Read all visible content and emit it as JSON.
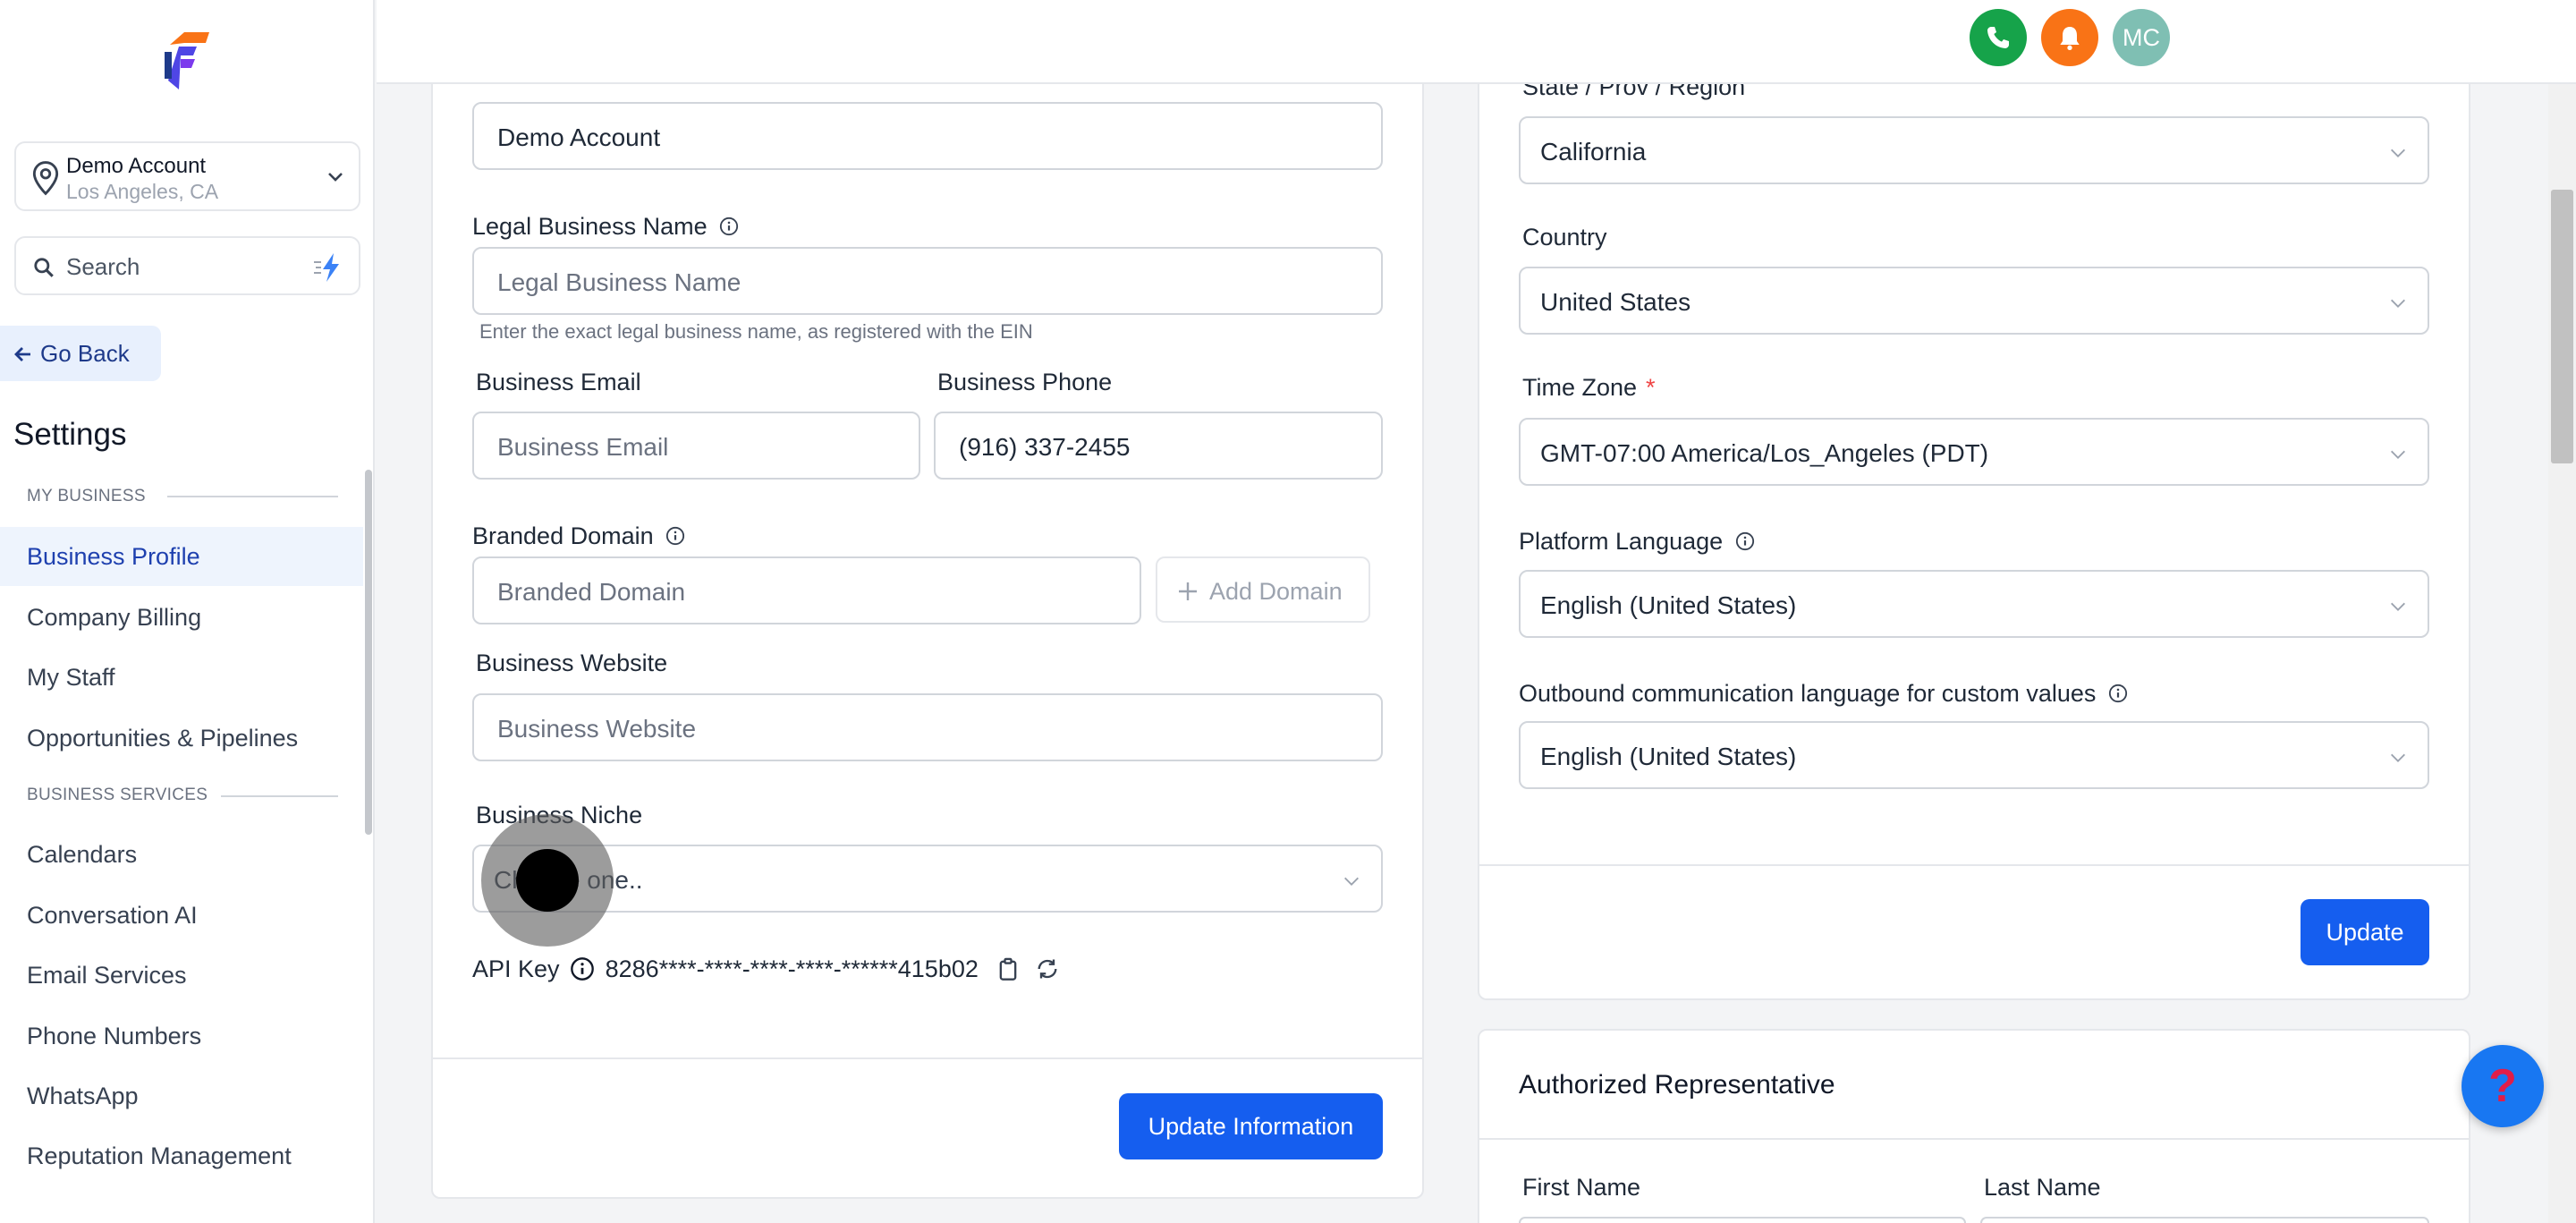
{
  "sidebar": {
    "account": {
      "name": "Demo Account",
      "location": "Los Angeles, CA"
    },
    "search": {
      "label": "Search"
    },
    "go_back": "Go Back",
    "title": "Settings",
    "sections": [
      {
        "heading": "MY BUSINESS",
        "items": [
          "Business Profile",
          "Company Billing",
          "My Staff",
          "Opportunities & Pipelines"
        ]
      },
      {
        "heading": "BUSINESS SERVICES",
        "items": [
          "Calendars",
          "Conversation AI",
          "Email Services",
          "Phone Numbers",
          "WhatsApp",
          "Reputation Management"
        ]
      }
    ],
    "active_item": "Business Profile"
  },
  "topbar": {
    "avatar_initials": "MC"
  },
  "business_info": {
    "friendly_name_value": "Demo Account",
    "legal_name": {
      "label": "Legal Business Name",
      "placeholder": "Legal Business Name",
      "hint": "Enter the exact legal business name, as registered with the EIN"
    },
    "email": {
      "label": "Business Email",
      "placeholder": "Business Email"
    },
    "phone": {
      "label": "Business Phone",
      "value": "(916) 337-2455"
    },
    "branded_domain": {
      "label": "Branded Domain",
      "placeholder": "Branded Domain",
      "add_label": "Add Domain"
    },
    "website": {
      "label": "Business Website",
      "placeholder": "Business Website"
    },
    "niche": {
      "label": "Business Niche",
      "placeholder": "Choose one.."
    },
    "api_key": {
      "label": "API Key",
      "value": "8286****-****-****-****-******415b02"
    },
    "update_button": "Update Information"
  },
  "address": {
    "state": {
      "label": "State / Prov / Region",
      "value": "California"
    },
    "country": {
      "label": "Country",
      "value": "United States"
    },
    "timezone": {
      "label": "Time Zone",
      "required_mark": "*",
      "value": "GMT-07:00 America/Los_Angeles (PDT)"
    },
    "platform_language": {
      "label": "Platform Language",
      "value": "English (United States)"
    },
    "outbound_language": {
      "label": "Outbound communication language for custom values",
      "value": "English (United States)"
    },
    "update_button": "Update"
  },
  "authorized_rep": {
    "title": "Authorized Representative",
    "first_name_label": "First Name",
    "last_name_label": "Last Name"
  },
  "help": {
    "glyph": "?"
  },
  "colors": {
    "primary": "#155eef",
    "active_nav_bg": "#eef4fd",
    "phone_icon": "#16a34a",
    "bell_icon": "#f97316",
    "avatar": "#7fbfb3"
  }
}
